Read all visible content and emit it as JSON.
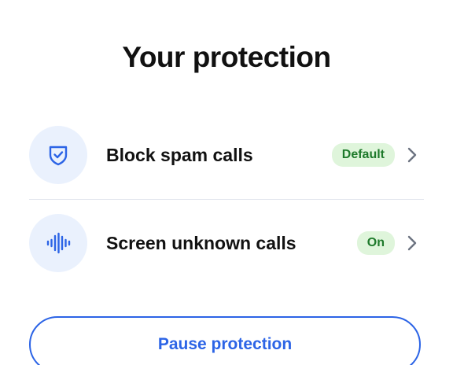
{
  "header": {
    "title": "Your protection"
  },
  "items": [
    {
      "label": "Block spam calls",
      "badge": "Default",
      "icon": "shield-check-icon"
    },
    {
      "label": "Screen unknown calls",
      "badge": "On",
      "icon": "sound-wave-icon"
    }
  ],
  "actions": {
    "pause_label": "Pause protection"
  },
  "colors": {
    "accent": "#2c64e6",
    "icon_bg": "#eaf1fd",
    "badge_bg": "#dff5db",
    "badge_text": "#1e7a2b",
    "chevron": "#6b7280"
  }
}
